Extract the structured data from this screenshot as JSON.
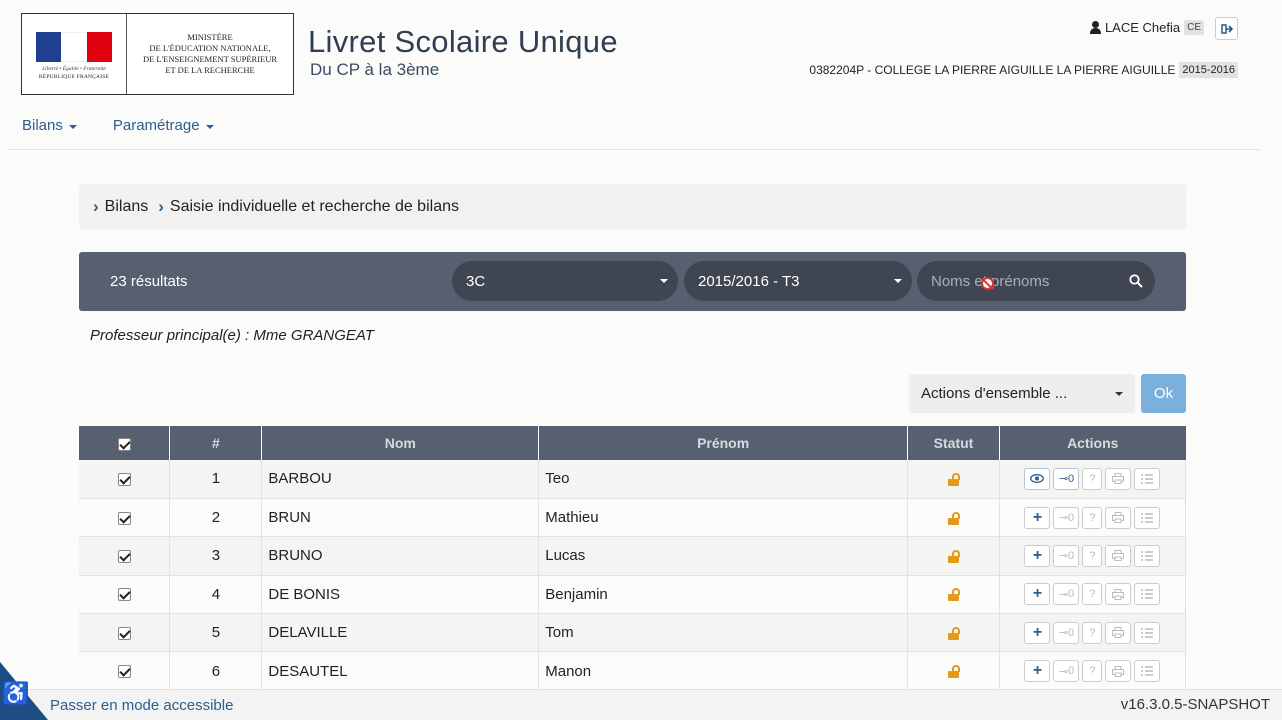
{
  "header": {
    "ministry_lines": [
      "MINISTÈRE",
      "DE L'ÉDUCATION NATIONALE,",
      "DE L'ENSEIGNEMENT SUPÉRIEUR",
      "ET DE LA RECHERCHE"
    ],
    "motto": "Liberté • Égalité • Fraternité",
    "republic": "RÉPUBLIQUE FRANÇAISE",
    "title": "Livret Scolaire Unique",
    "subtitle": "Du CP à la 3ème",
    "user_name": "LACE Chefia",
    "user_role": "CE",
    "school": "0382204P - COLLEGE LA PIERRE AIGUILLE LA PIERRE AIGUILLE",
    "school_year": "2015-2016"
  },
  "nav": {
    "bilans": "Bilans",
    "parametrage": "Paramétrage"
  },
  "breadcrumb": {
    "level1": "Bilans",
    "level2": "Saisie individuelle et recherche de bilans"
  },
  "filters": {
    "results": "23 résultats",
    "class_value": "3C",
    "period_value": "2015/2016 - T3",
    "search_placeholder": "Noms et prénoms"
  },
  "professor": "Professeur principal(e) : Mme GRANGEAT",
  "bulk": {
    "actions_label": "Actions d'ensemble ...",
    "ok_label": "Ok"
  },
  "table": {
    "headers": {
      "num": "#",
      "nom": "Nom",
      "prenom": "Prénom",
      "statut": "Statut",
      "actions": "Actions"
    },
    "rows": [
      {
        "num": "1",
        "nom": "BARBOU",
        "prenom": "Teo",
        "first_action": "eye",
        "count": "0"
      },
      {
        "num": "2",
        "nom": "BRUN",
        "prenom": "Mathieu",
        "first_action": "plus",
        "count": "0"
      },
      {
        "num": "3",
        "nom": "BRUNO",
        "prenom": "Lucas",
        "first_action": "plus",
        "count": "0"
      },
      {
        "num": "4",
        "nom": "DE BONIS",
        "prenom": "Benjamin",
        "first_action": "plus",
        "count": "0"
      },
      {
        "num": "5",
        "nom": "DELAVILLE",
        "prenom": "Tom",
        "first_action": "plus",
        "count": "0"
      },
      {
        "num": "6",
        "nom": "DESAUTEL",
        "prenom": "Manon",
        "first_action": "plus",
        "count": "0"
      }
    ]
  },
  "footer": {
    "accessible_link": "Passer en mode accessible",
    "version": "v16.3.0.5-SNAPSHOT"
  },
  "colors": {
    "header_bar": "#566070",
    "link_blue": "#2b5f8f",
    "lock_orange": "#e39a1a",
    "ok_button": "#7bafdc"
  }
}
